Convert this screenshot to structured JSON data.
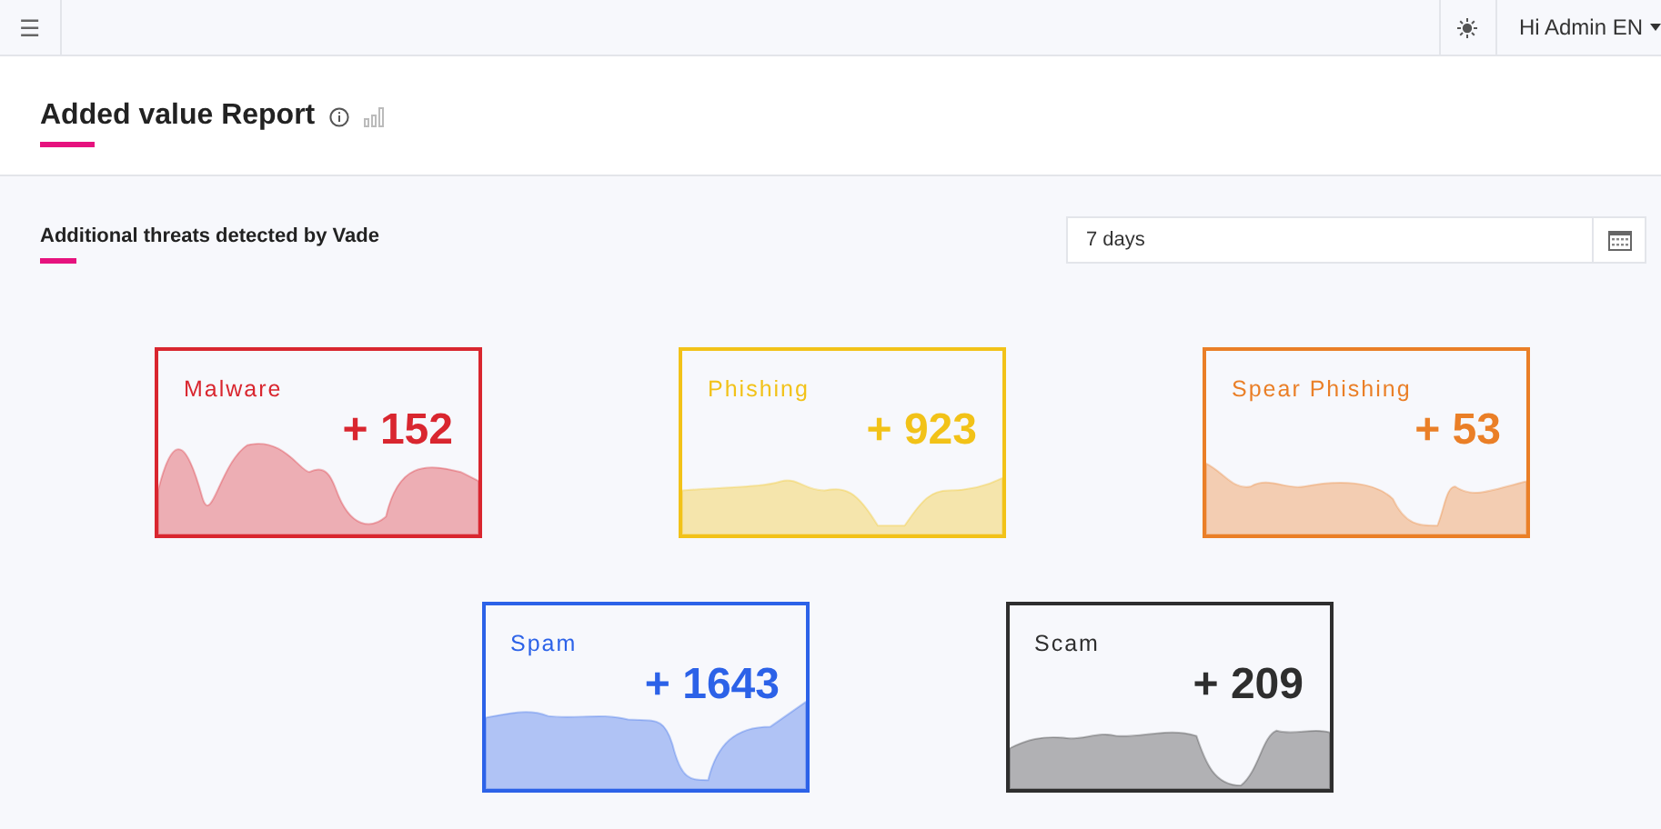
{
  "topbar": {
    "menu_icon": "☰",
    "user": "Hi Admin EN"
  },
  "page": {
    "title": "Added value Report"
  },
  "section": {
    "title": "Additional threats detected by Vade",
    "period": "7 days"
  },
  "cards": [
    {
      "label": "Malware",
      "value": "+ 152",
      "color": "#d9262f"
    },
    {
      "label": "Phishing",
      "value": "+ 923",
      "color": "#f2c218"
    },
    {
      "label": "Spear Phishing",
      "value": "+ 53",
      "color": "#ea7f27"
    },
    {
      "label": "Spam",
      "value": "+ 1643",
      "color": "#2c62e8"
    },
    {
      "label": "Scam",
      "value": "+ 209",
      "color": "#2e2e2e"
    }
  ]
}
